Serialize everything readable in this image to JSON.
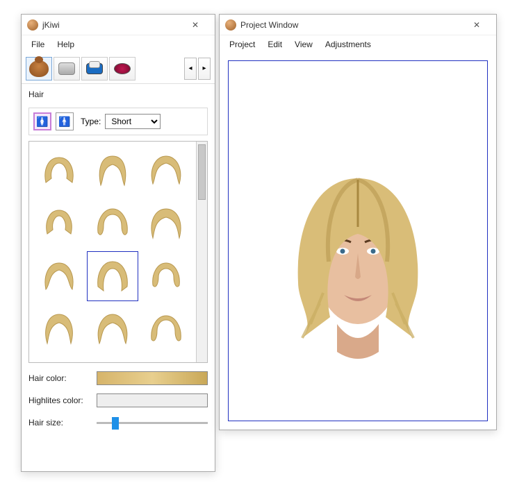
{
  "left_window": {
    "title": "jKiwi",
    "menu": [
      "File",
      "Help"
    ],
    "toolbar": {
      "tabs": [
        "hair",
        "face-cream",
        "eyeshadow",
        "blush"
      ],
      "active_index": 0
    },
    "section_label": "Hair",
    "gender": {
      "female_active": true
    },
    "type": {
      "label": "Type:",
      "selected": "Short",
      "options": [
        "Short"
      ]
    },
    "thumbs": {
      "count": 12,
      "selected_index": 7
    },
    "hair_color_label": "Hair color:",
    "highlites_label": "Highlites color:",
    "hair_size_label": "Hair size:",
    "slider_percent": 14
  },
  "right_window": {
    "title": "Project Window",
    "menu": [
      "Project",
      "Edit",
      "View",
      "Adjustments"
    ]
  }
}
